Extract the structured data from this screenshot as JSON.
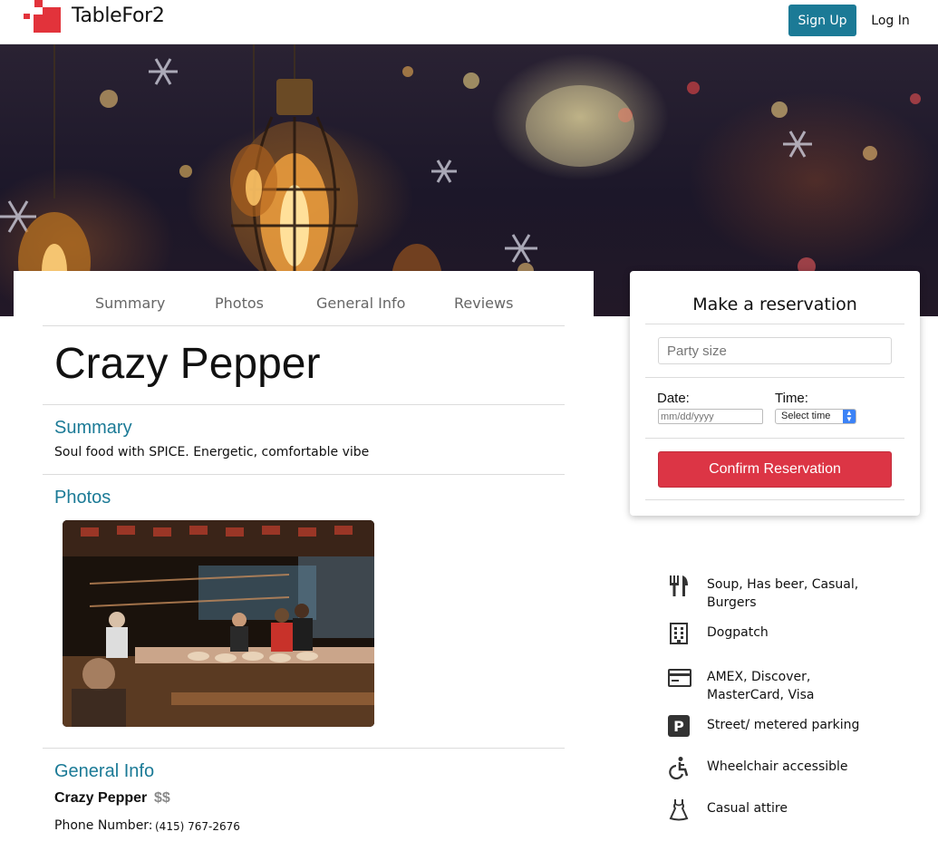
{
  "navbar": {
    "brand": "TableFor2",
    "signup_label": "Sign Up",
    "login_label": "Log In",
    "logo_color": "#e2333b",
    "accent_color": "#1b7a96"
  },
  "tabs": [
    {
      "label": "Summary"
    },
    {
      "label": "Photos"
    },
    {
      "label": "General Info"
    },
    {
      "label": "Reviews"
    }
  ],
  "restaurant": {
    "name": "Crazy Pepper",
    "summary_title": "Summary",
    "summary": "Soul food with SPICE. Energetic, comfortable vibe",
    "photos_title": "Photos",
    "general_info_title": "General Info",
    "info_name": "Crazy Pepper",
    "price": "$$",
    "phone_label": "Phone Number:",
    "phone": "(415) 767-2676"
  },
  "reservation": {
    "title": "Make a reservation",
    "party_placeholder": "Party size",
    "date_label": "Date:",
    "date_placeholder": "mm/dd/yyyy",
    "time_label": "Time:",
    "time_selected": "Select time",
    "confirm_label": "Confirm Reservation",
    "confirm_color": "#dc3545"
  },
  "features": [
    {
      "icon": "utensils-icon",
      "text": "Soup, Has beer, Casual, Burgers"
    },
    {
      "icon": "building-icon",
      "text": "Dogpatch"
    },
    {
      "icon": "credit-card-icon",
      "text": "AMEX, Discover, MasterCard, Visa"
    },
    {
      "icon": "parking-icon",
      "text": "Street/ metered parking"
    },
    {
      "icon": "wheelchair-icon",
      "text": "Wheelchair accessible"
    },
    {
      "icon": "dress-icon",
      "text": "Casual attire"
    }
  ]
}
